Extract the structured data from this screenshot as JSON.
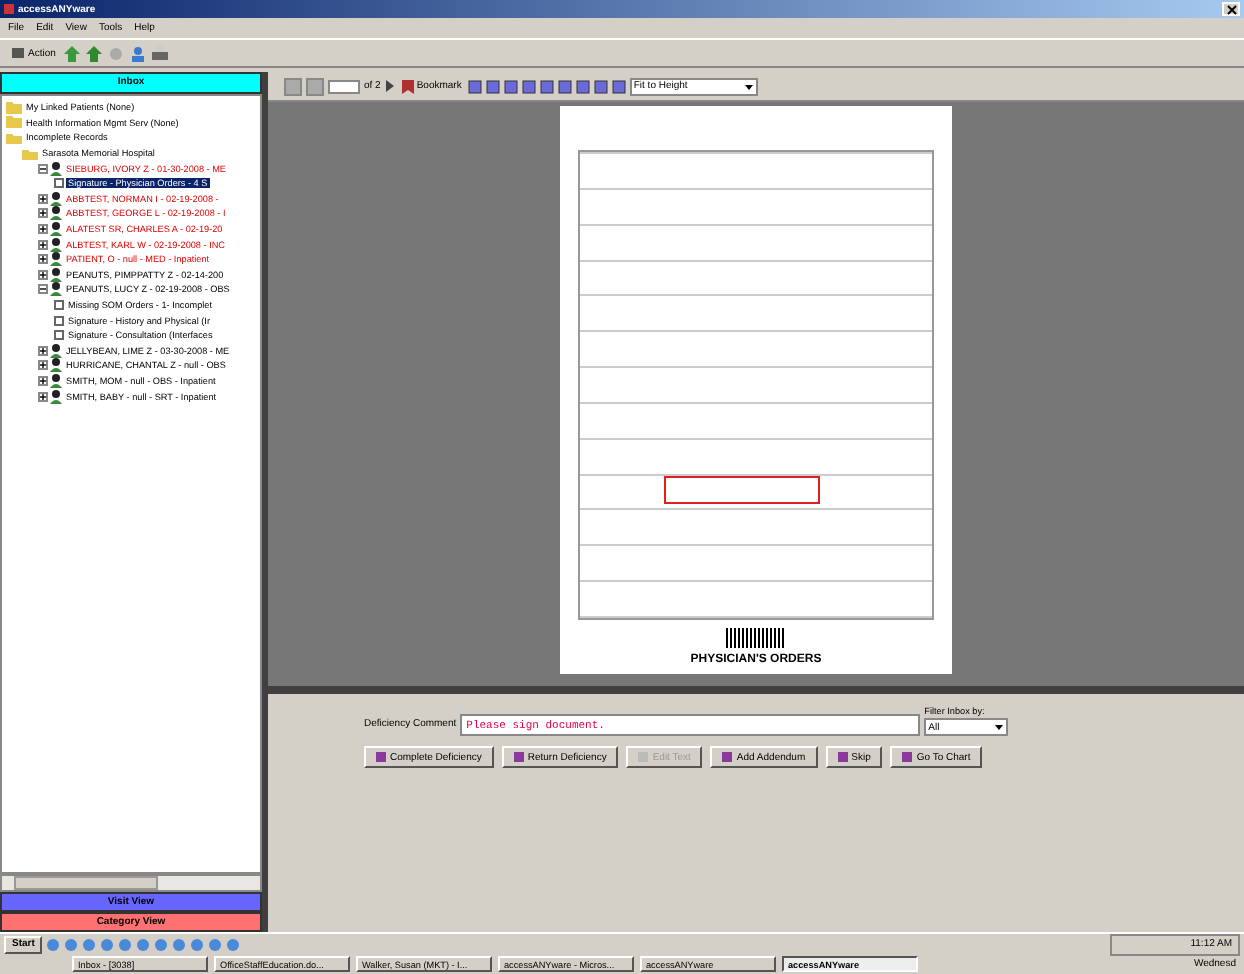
{
  "window": {
    "title": "accessANYware"
  },
  "menu": [
    "File",
    "Edit",
    "View",
    "Tools",
    "Help"
  ],
  "toolbar": {
    "action_label": "Action"
  },
  "inbox": {
    "title": "Inbox",
    "tree": [
      {
        "kind": "folder",
        "label": "My Linked Patients (None)",
        "flagged": false,
        "selected": false
      },
      {
        "kind": "folder",
        "label": "Health Information Mgmt Serv (None)",
        "flagged": false,
        "selected": false
      },
      {
        "kind": "folder",
        "label": "Incomplete Records",
        "flagged": false,
        "selected": false,
        "expanded": true,
        "children": [
          {
            "kind": "folder",
            "label": "Sarasota Memorial Hospital",
            "flagged": false,
            "selected": false,
            "expanded": true,
            "children": [
              {
                "kind": "patient",
                "label": "SIEBURG, IVORY Z - 01-30-2008 - ME",
                "flagged": true,
                "selected": false,
                "expanded": true,
                "children": [
                  {
                    "kind": "task",
                    "label": "Signature - Physician Orders - 4 S",
                    "flagged": false,
                    "selected": true,
                    "checked": false
                  }
                ]
              },
              {
                "kind": "patient",
                "label": "ABBTEST, NORMAN I - 02-19-2008 -",
                "flagged": true,
                "selected": false,
                "expanded": false
              },
              {
                "kind": "patient",
                "label": "ABBTEST, GEORGE L - 02-19-2008 - I",
                "flagged": true,
                "selected": false,
                "expanded": false
              },
              {
                "kind": "patient",
                "label": "ALATEST SR, CHARLES A - 02-19-20",
                "flagged": true,
                "selected": false,
                "expanded": false
              },
              {
                "kind": "patient",
                "label": "ALBTEST, KARL W - 02-19-2008 - INC",
                "flagged": true,
                "selected": false,
                "expanded": false
              },
              {
                "kind": "patient",
                "label": "PATIENT, O - null - MED - Inpatient",
                "flagged": true,
                "selected": false,
                "expanded": false
              },
              {
                "kind": "patient",
                "label": "PEANUTS, PIMPPATTY Z - 02-14-200",
                "flagged": false,
                "selected": false,
                "expanded": false
              },
              {
                "kind": "patient",
                "label": "PEANUTS, LUCY Z - 02-19-2008 - OBS",
                "flagged": false,
                "selected": false,
                "expanded": true,
                "children": [
                  {
                    "kind": "task",
                    "label": "Missing SOM Orders - 1- Incomplet",
                    "flagged": false,
                    "selected": false,
                    "checked": false
                  },
                  {
                    "kind": "task",
                    "label": "Signature - History and Physical (Ir",
                    "flagged": false,
                    "selected": false,
                    "checked": false
                  },
                  {
                    "kind": "task",
                    "label": "Signature - Consultation (Interfaces",
                    "flagged": false,
                    "selected": false,
                    "checked": false
                  }
                ]
              },
              {
                "kind": "patient",
                "label": "JELLYBEAN, LIME Z - 03-30-2008 - ME",
                "flagged": false,
                "selected": false,
                "expanded": false
              },
              {
                "kind": "patient",
                "label": "HURRICANE, CHANTAL Z - null - OBS",
                "flagged": false,
                "selected": false,
                "expanded": false
              },
              {
                "kind": "patient",
                "label": "SMITH, MOM - null - OBS - Inpatient",
                "flagged": false,
                "selected": false,
                "expanded": false
              },
              {
                "kind": "patient",
                "label": "SMITH, BABY - null - SRT - Inpatient",
                "flagged": false,
                "selected": false,
                "expanded": false
              }
            ]
          }
        ]
      }
    ]
  },
  "views": [
    {
      "label": "Visit View",
      "color": "#6666ff"
    },
    {
      "label": "Category View",
      "color": "#ff7070"
    }
  ],
  "viewer": {
    "page_of": "of 2",
    "bookmark": "Bookmark",
    "zoom": "Fit to Height",
    "document_title": "PHYSICIAN'S ORDERS"
  },
  "deficiency": {
    "comment_label": "Deficiency Comment",
    "comment": "Please sign document.",
    "filter_label": "Filter Inbox by:",
    "filter_value": "All"
  },
  "actions": [
    {
      "label": "Complete Deficiency",
      "disabled": false
    },
    {
      "label": "Return Deficiency",
      "disabled": false
    },
    {
      "label": "Edit Text",
      "disabled": true
    },
    {
      "label": "Add Addendum",
      "disabled": false
    },
    {
      "label": "Skip",
      "disabled": false
    },
    {
      "label": "Go To Chart",
      "disabled": false
    }
  ],
  "taskbar": {
    "start": "Start",
    "tasks": [
      {
        "label": "Inbox - [3038]",
        "selected": false
      },
      {
        "label": "OfficeStaffEducation.do...",
        "selected": false
      },
      {
        "label": "Walker, Susan (MKT) - I...",
        "selected": false
      },
      {
        "label": "accessANYware - Micros...",
        "selected": false
      },
      {
        "label": "accessANYware",
        "selected": false
      },
      {
        "label": "accessANYware",
        "selected": true
      }
    ],
    "clock": "11:12 AM",
    "day": "Wednesd"
  }
}
